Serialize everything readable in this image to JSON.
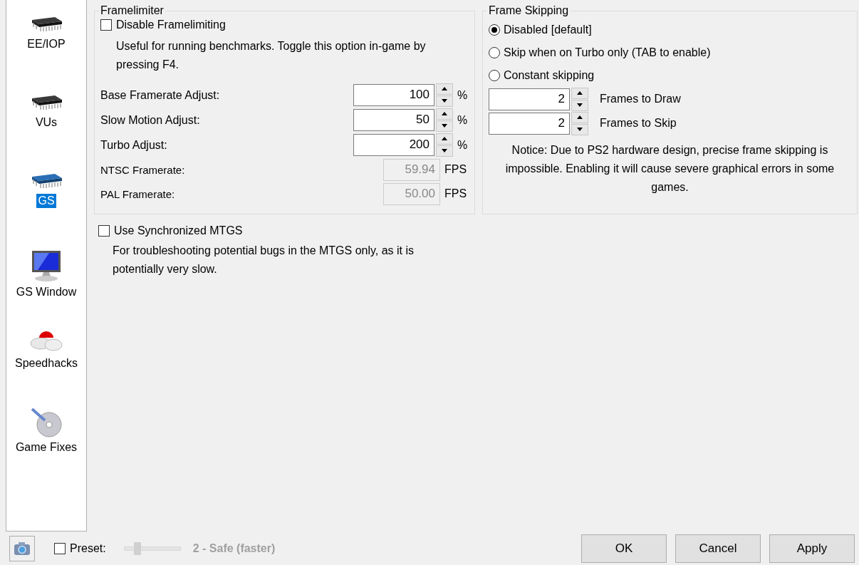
{
  "sidebar": {
    "items": [
      {
        "label": "EE/IOP",
        "selected": false
      },
      {
        "label": "VUs",
        "selected": false
      },
      {
        "label": "GS",
        "selected": true
      },
      {
        "label": "GS Window",
        "selected": false
      },
      {
        "label": "Speedhacks",
        "selected": false
      },
      {
        "label": "Game Fixes",
        "selected": false
      }
    ]
  },
  "framelimiter": {
    "title": "Framelimiter",
    "disable": {
      "label": "Disable Framelimiting",
      "checked": false,
      "description": "Useful for running benchmarks. Toggle this option in-game by pressing F4."
    },
    "adjust": [
      {
        "label": "Base Framerate Adjust:",
        "value": "100",
        "unit": "%"
      },
      {
        "label": "Slow Motion Adjust:",
        "value": "50",
        "unit": "%"
      },
      {
        "label": "Turbo Adjust:",
        "value": "200",
        "unit": "%"
      }
    ],
    "rates": [
      {
        "label": "NTSC Framerate:",
        "value": "59.94",
        "unit": "FPS",
        "disabled": true
      },
      {
        "label": "PAL Framerate:",
        "value": "50.00",
        "unit": "FPS",
        "disabled": true
      }
    ]
  },
  "mtgs": {
    "label": "Use Synchronized MTGS",
    "checked": false,
    "description": "For troubleshooting potential bugs in the MTGS only, as it is potentially very slow."
  },
  "frame_skipping": {
    "title": "Frame Skipping",
    "options": [
      {
        "label": "Disabled [default]",
        "selected": true
      },
      {
        "label": "Skip when on Turbo only (TAB to enable)",
        "selected": false
      },
      {
        "label": "Constant skipping",
        "selected": false
      }
    ],
    "spinners": [
      {
        "value": "2",
        "label": "Frames to Draw"
      },
      {
        "value": "2",
        "label": "Frames to Skip"
      }
    ],
    "notice": "Notice: Due to PS2 hardware design, precise frame skipping is impossible. Enabling it will cause severe graphical errors in some games."
  },
  "footer": {
    "preset": {
      "label": "Preset:",
      "checked": false,
      "level": 0.23,
      "value": "2 - Safe (faster)"
    },
    "buttons": [
      "OK",
      "Cancel",
      "Apply"
    ]
  }
}
